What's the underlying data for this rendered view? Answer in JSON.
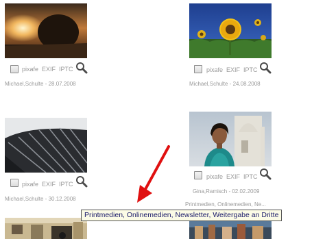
{
  "items": [
    {
      "caption": "Michael,Schulte - 28.07.2008",
      "links": [
        "pixafe",
        "EXIF",
        "IPTC"
      ]
    },
    {
      "caption": "Michael,Schulte - 24.08.2008",
      "links": [
        "pixafe",
        "EXIF",
        "IPTC"
      ]
    },
    {
      "caption": "Michael,Schulte - 30.12.2008",
      "links": [
        "pixafe",
        "EXIF",
        "IPTC"
      ]
    },
    {
      "caption": "Gina,Ramisch - 02.02.2009",
      "links": [
        "pixafe",
        "EXIF",
        "IPTC"
      ],
      "usage": "Printmedien, Onlinemedien, Ne..."
    }
  ],
  "tooltip": "Printmedien, Onlinemedien, Newsletter, Weitergabe an Dritte",
  "icons": {
    "zoom": "magnifier-icon",
    "checkbox": "checkbox-icon"
  },
  "colors": {
    "text": "#9a9a9a",
    "tooltip_bg": "#fbfbe6",
    "arrow": "#e01010"
  }
}
